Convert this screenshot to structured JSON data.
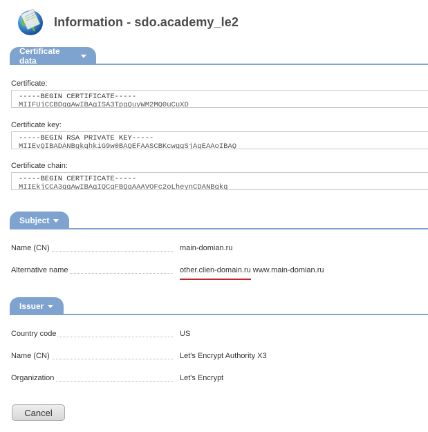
{
  "header": {
    "title": "Information - sdo.academy_le2",
    "icon": "globe-icon"
  },
  "certificate_section": {
    "tab_label": "Certificate data",
    "certificate": {
      "label": "Certificate:",
      "line1": "-----BEGIN CERTIFICATE-----",
      "line2": "MIIFUjCCBDqgAwIBAgISA3TpgQuyWM2MQ0uCuXD"
    },
    "key": {
      "label": "Certificate key:",
      "line1": "-----BEGIN RSA PRIVATE KEY-----",
      "line2": "MIIEvQIBADANBgkqhkiG9w0BAQEFAASCBKcwggSjAgEAAoIBAQ"
    },
    "chain": {
      "label": "Certificate chain:",
      "line1": "-----BEGIN CERTIFICATE-----",
      "line2": "MIIEkjCCA3qgAwIBAgIQCgFBQgAAAVOFc2oLheynCDANBgkq"
    }
  },
  "subject_section": {
    "tab_label": "Subject",
    "name_label": "Name (CN)",
    "name_value": "main-domian.ru",
    "alt_label": "Alternative name",
    "alt_value_1": "other.clien-domain.ru",
    "alt_value_2": "www.main-domian.ru"
  },
  "issuer_section": {
    "tab_label": "Issuer",
    "country_label": "Country code",
    "country_value": "US",
    "name_label": "Name (CN)",
    "name_value": "Let's Encrypt Authority X3",
    "org_label": "Organization",
    "org_value": "Let's Encrypt"
  },
  "buttons": {
    "cancel": "Cancel"
  },
  "colors": {
    "accent": "#7ea3cf",
    "underline": "#c0242c"
  }
}
